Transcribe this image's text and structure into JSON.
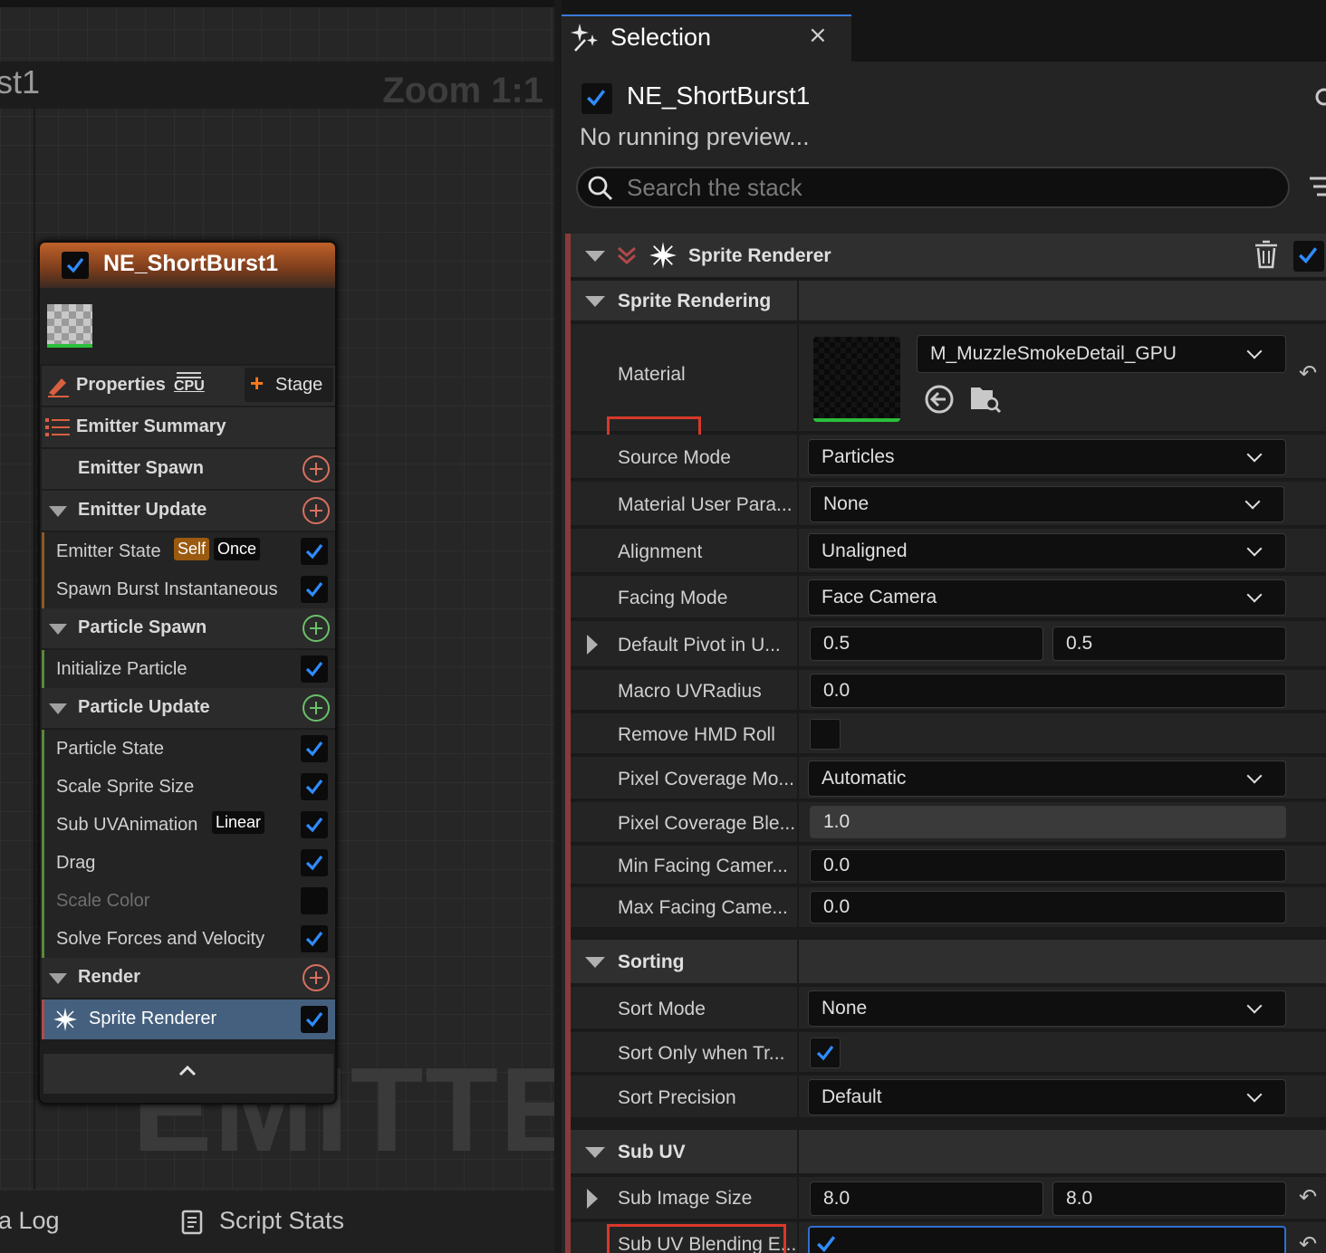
{
  "graph": {
    "title_fragment": "st1",
    "zoom": "Zoom 1:1",
    "watermark": "EMITTER",
    "bottom_tabs": [
      "a Log",
      "Script Stats"
    ]
  },
  "node": {
    "title": "NE_ShortBurst1",
    "properties_label": "Properties",
    "cpu_label": "CPU",
    "stage_label": "Stage",
    "summary_label": "Emitter Summary",
    "rows": [
      {
        "label": "Emitter Spawn",
        "kind": "head-noexp",
        "action": "add-red"
      },
      {
        "label": "Emitter Update",
        "kind": "head",
        "action": "add-red"
      },
      {
        "label": "Emitter State",
        "kind": "item",
        "tags": [
          "Self",
          "Once"
        ],
        "checked": true,
        "bar": "orange"
      },
      {
        "label": "Spawn Burst Instantaneous",
        "kind": "item",
        "checked": true,
        "bar": "orange"
      },
      {
        "label": "Particle Spawn",
        "kind": "head",
        "action": "add-green"
      },
      {
        "label": "Initialize Particle",
        "kind": "item",
        "checked": true,
        "bar": "green"
      },
      {
        "label": "Particle Update",
        "kind": "head",
        "action": "add-green"
      },
      {
        "label": "Particle State",
        "kind": "item",
        "checked": true,
        "bar": "green"
      },
      {
        "label": "Scale Sprite Size",
        "kind": "item",
        "checked": true,
        "bar": "green"
      },
      {
        "label": "Sub UVAnimation",
        "kind": "item",
        "tags": [
          "Linear"
        ],
        "checked": true,
        "bar": "green"
      },
      {
        "label": "Drag",
        "kind": "item",
        "checked": true,
        "bar": "green"
      },
      {
        "label": "Scale Color",
        "kind": "item",
        "checked": false,
        "disabled": true,
        "bar": "green"
      },
      {
        "label": "Solve Forces and Velocity",
        "kind": "item",
        "checked": true,
        "bar": "green"
      },
      {
        "label": "Render",
        "kind": "head",
        "action": "add-red"
      },
      {
        "label": "Sprite Renderer",
        "kind": "selected",
        "checked": true,
        "bar": "red"
      }
    ]
  },
  "panel": {
    "tab_label": "Selection",
    "tab_close": "×",
    "system_name": "NE_ShortBurst1",
    "preview_status": "No running preview...",
    "search_placeholder": "Search the stack",
    "renderer_title": "Sprite Renderer",
    "sections": {
      "sprite_rendering": "Sprite Rendering",
      "sorting": "Sorting",
      "sub_uv": "Sub UV"
    },
    "material": {
      "label": "Material",
      "value": "M_MuzzleSmokeDetail_GPU"
    },
    "props": {
      "source_mode": {
        "label": "Source Mode",
        "value": "Particles"
      },
      "material_user_param": {
        "label": "Material User Para...",
        "value": "None"
      },
      "alignment": {
        "label": "Alignment",
        "value": "Unaligned"
      },
      "facing_mode": {
        "label": "Facing Mode",
        "value": "Face Camera"
      },
      "default_pivot": {
        "label": "Default Pivot in U...",
        "x": "0.5",
        "y": "0.5"
      },
      "macro_uv_radius": {
        "label": "Macro UVRadius",
        "value": "0.0"
      },
      "remove_hmd_roll": {
        "label": "Remove HMD Roll",
        "checked": false
      },
      "pixel_coverage_mode": {
        "label": "Pixel Coverage Mo...",
        "value": "Automatic"
      },
      "pixel_coverage_blend": {
        "label": "Pixel Coverage Ble...",
        "value": "1.0"
      },
      "min_facing": {
        "label": "Min Facing Camer...",
        "value": "0.0"
      },
      "max_facing": {
        "label": "Max Facing Came...",
        "value": "0.0"
      },
      "sort_mode": {
        "label": "Sort Mode",
        "value": "None"
      },
      "sort_only_when": {
        "label": "Sort Only when Tr...",
        "checked": true
      },
      "sort_precision": {
        "label": "Sort Precision",
        "value": "Default"
      },
      "sub_image_size": {
        "label": "Sub Image Size",
        "x": "8.0",
        "y": "8.0"
      },
      "sub_uv_blending": {
        "label": "Sub UV Blending E...",
        "checked": true
      }
    },
    "colors": {
      "accent": "#3a7ad8",
      "highlight_box": "#d8382a",
      "check": "#2f8cff"
    }
  }
}
